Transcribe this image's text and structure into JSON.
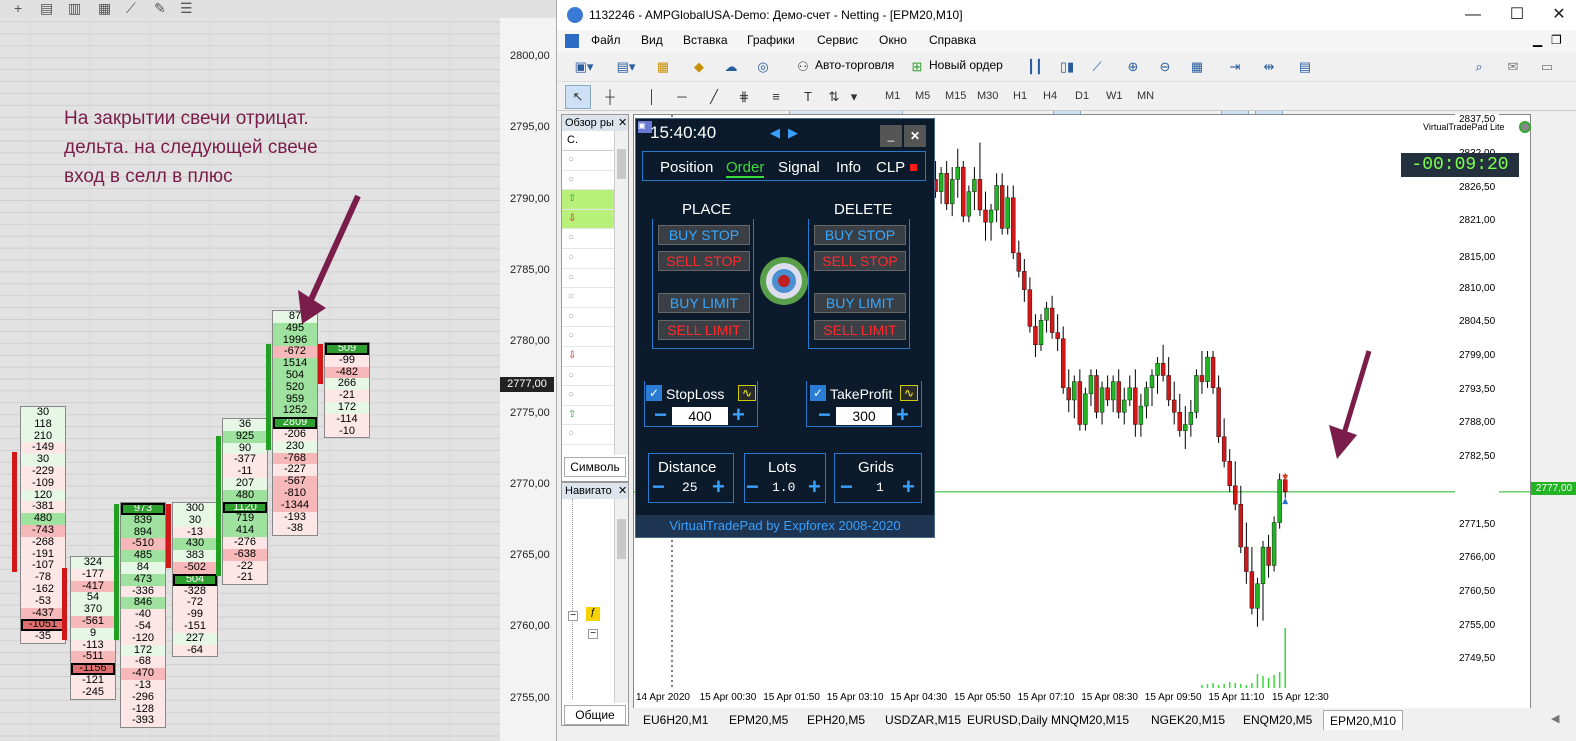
{
  "left": {
    "annotation": "На закрытии свечи отрицат.\nдельта. на следующей свече\nвход в селл в плюс",
    "price_labels": [
      "2800,00",
      "2795,00",
      "2790,00",
      "2785,00",
      "2780,00",
      "2775,00",
      "2770,00",
      "2765,00",
      "2760,00",
      "2755,00"
    ],
    "current_price": "2777,00",
    "columns": [
      {
        "cells": [
          "30",
          "118",
          "210",
          "-149",
          "30",
          "-229",
          "-109",
          "120",
          "-381",
          "480",
          "-743",
          "-268",
          "-191",
          "-107",
          "-78",
          "-162",
          "-53",
          "-437",
          "-1051",
          "-35"
        ]
      },
      {
        "cells": [
          "324",
          "-177",
          "-417",
          "54",
          "370",
          "-561",
          "9",
          "-113",
          "-511",
          "-1156",
          "-121",
          "-245"
        ]
      },
      {
        "cells": [
          "973",
          "839",
          "894",
          "-510",
          "485",
          "84",
          "473",
          "-336",
          "846",
          "-40",
          "-54",
          "-120",
          "172",
          "-68",
          "-470",
          "-13",
          "-296",
          "-128",
          "-393"
        ]
      },
      {
        "cells": [
          "300",
          "30",
          "-13",
          "430",
          "383",
          "-502",
          "504",
          "-328",
          "-72",
          "-99",
          "-151",
          "227",
          "-64"
        ]
      },
      {
        "cells": [
          "36",
          "925",
          "90",
          "-377",
          "-11",
          "207",
          "480",
          "1120",
          "719",
          "414",
          "-276",
          "-638",
          "-22",
          "-21"
        ]
      },
      {
        "cells": [
          "87",
          "495",
          "1996",
          "-672",
          "1514",
          "504",
          "520",
          "959",
          "1252",
          "2809",
          "-206",
          "230",
          "-768",
          "-227",
          "-567",
          "-810",
          "-1344",
          "-193",
          "-38"
        ]
      },
      {
        "cells": [
          "509",
          "-99",
          "-482",
          "266",
          "-21",
          "172",
          "-114",
          "-10"
        ]
      }
    ]
  },
  "mt": {
    "title": "1132246 - AMPGlobalUSA-Demo: Демо-счет - Netting - [EPM20,M10]",
    "menu": [
      "Файл",
      "Вид",
      "Вставка",
      "Графики",
      "Сервис",
      "Окно",
      "Справка"
    ],
    "autotrade": "Авто-торговля",
    "neworder": "Новый ордер",
    "timeframes": [
      "M1",
      "M5",
      "M15",
      "M30",
      "H1",
      "H4",
      "D1",
      "W1",
      "MN"
    ],
    "marketwatch": {
      "title": "Обзор ры",
      "col": "С.",
      "tab": "Символь"
    },
    "navigator": {
      "title": "Навигато",
      "tab": "Общие"
    },
    "chart": {
      "y_labels": [
        "2837,50",
        "2832,00",
        "2826,50",
        "2821,00",
        "2815,00",
        "2810,00",
        "2804,50",
        "2799,00",
        "2793,50",
        "2788,00",
        "2782,50",
        "2777,00",
        "2771,50",
        "2766,00",
        "2760,50",
        "2755,00",
        "2749,50"
      ],
      "x_labels": [
        "14 Apr 2020",
        "15 Apr 00:30",
        "15 Apr 01:50",
        "15 Apr 03:10",
        "15 Apr 04:30",
        "15 Apr 05:50",
        "15 Apr 07:10",
        "15 Apr 08:30",
        "15 Apr 09:50",
        "15 Apr 11:10",
        "15 Apr 12:30"
      ],
      "price_tag": "2777,00",
      "countdown": "-00:09:20",
      "brand": "VirtualTradePad  Lite"
    },
    "vtp": {
      "time": "15:40:40",
      "tabs": [
        "Position",
        "Order",
        "Signal",
        "Info",
        "CLP"
      ],
      "place": "PLACE",
      "delete": "DELETE",
      "buy_stop": "BUY STOP",
      "sell_stop": "SELL STOP",
      "buy_limit": "BUY LIMIT",
      "sell_limit": "SELL LIMIT",
      "stoploss": "StopLoss",
      "stoploss_val": "400",
      "takeprofit": "TakeProfit",
      "takeprofit_val": "300",
      "distance": "Distance",
      "distance_val": "25",
      "lots": "Lots",
      "lots_val": "1.0",
      "grids": "Grids",
      "grids_val": "1",
      "footer": "VirtualTradePad by Expforex 2008-2020"
    },
    "tabs": [
      "EU6H20,M1",
      "EPM20,M5",
      "EPH20,M5",
      "USDZAR,M15",
      "EURUSD,Daily",
      "MNQM20,M15",
      "NGEK20,M15",
      "ENQM20,M5",
      "EPM20,M10"
    ],
    "colors": {
      "accent": "#7a1d4b",
      "bull": "#22b422",
      "bear": "#d01818"
    }
  }
}
